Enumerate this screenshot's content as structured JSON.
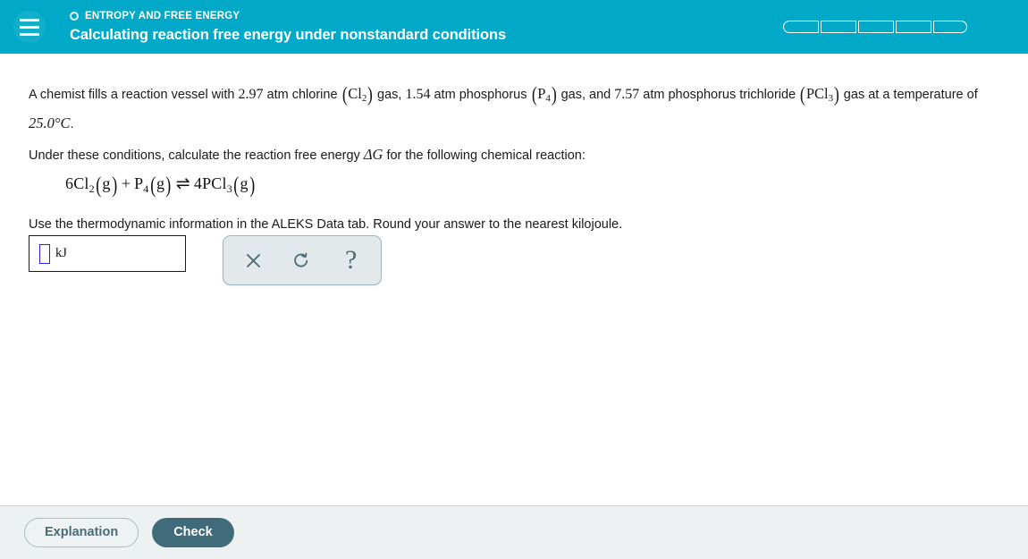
{
  "header": {
    "menu_icon": "hamburger-icon",
    "eyebrow_icon": "circle-outline-icon",
    "eyebrow": "ENTROPY AND FREE ENERGY",
    "title": "Calculating reaction free energy under nonstandard conditions",
    "progress": {
      "total_segments": 5,
      "filled_segments": 0
    },
    "accent_color": "#00a9c7"
  },
  "drawer_tab": {
    "icon": "chevron-down-icon",
    "color": "#c6ecf4"
  },
  "problem": {
    "paragraph_1": {
      "t1": "A chemist fills a reaction vessel with ",
      "v1": "2.97",
      "t2": " atm chlorine ",
      "f1_main": "Cl",
      "f1_sub": "2",
      "t3": " gas, ",
      "v2": "1.54",
      "t4": " atm phosphorus ",
      "f2_main": "P",
      "f2_sub": "4",
      "t5": " gas, and ",
      "v3": "7.57",
      "t6": " atm phosphorus trichloride ",
      "f3_main": "PCl",
      "f3_sub": "3",
      "t7": " gas at a temperature of ",
      "v4": "25.0°C",
      "t8": "."
    },
    "paragraph_2": {
      "t1": "Under these conditions, calculate the reaction free energy ",
      "sym": "ΔG",
      "t2": " for the following chemical reaction:"
    },
    "equation": {
      "coeff1": "6",
      "r1": "Cl",
      "r1sub": "2",
      "r1state": "g",
      "plus": "+",
      "r2": "P",
      "r2sub": "4",
      "r2state": "g",
      "arrow": "⇌",
      "coeff2": "4",
      "p1": "PCl",
      "p1sub": "3",
      "p1state": "g"
    },
    "paragraph_3": "Use the thermodynamic information in the ALEKS Data tab. Round your answer to the nearest kilojoule."
  },
  "answer": {
    "value": "",
    "placeholder": "",
    "unit": "kJ"
  },
  "toolbar": {
    "clear_icon": "close-x-icon",
    "undo_icon": "undo-arrow-icon",
    "help_icon": "question-mark-icon",
    "help_label": "?"
  },
  "footer": {
    "explanation_label": "Explanation",
    "check_label": "Check"
  }
}
